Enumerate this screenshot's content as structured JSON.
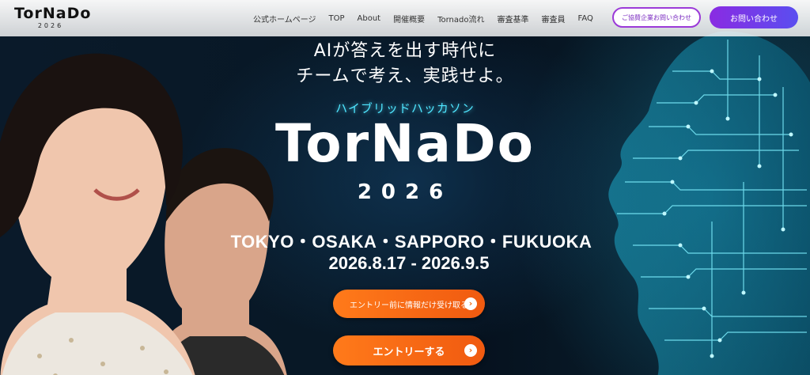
{
  "header": {
    "logo": "TorNaDo",
    "logo_year": "2026",
    "nav": [
      {
        "label": "公式ホームページ"
      },
      {
        "label": "TOP"
      },
      {
        "label": "About"
      },
      {
        "label": "開催概要"
      },
      {
        "label": "Tornado流れ"
      },
      {
        "label": "審査基準"
      },
      {
        "label": "審査員"
      },
      {
        "label": "FAQ"
      }
    ],
    "partner_button": "ご協賛企業お問い合わせ",
    "contact_button": "お問い合わせ"
  },
  "hero": {
    "tagline_line1": "AIが答えを出す時代に",
    "tagline_line2": "チームで考え、実践せよ。",
    "subtitle": "ハイブリッドハッカソン",
    "title": "TorNaDo",
    "year": "2026",
    "cities": "TOKYO・OSAKA・SAPPORO・FUKUOKA",
    "dates": "2026.8.17 - 2026.9.5",
    "cta_info": "エントリー前に情報だけ受け取る",
    "cta_entry": "エントリーする",
    "arrow_icon": "chevron-right-icon"
  },
  "colors": {
    "accent_orange": "#f06a14",
    "accent_purple": "#8a2be2",
    "subtitle_cyan": "#4fe6ff"
  }
}
